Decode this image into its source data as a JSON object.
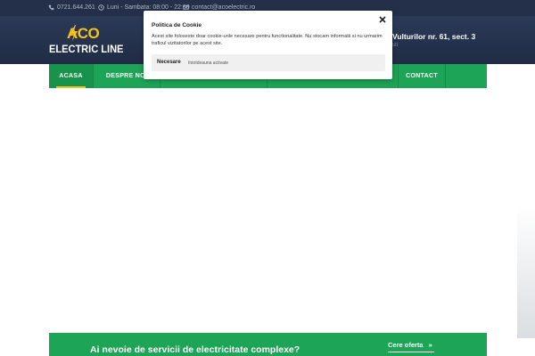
{
  "topbar": {
    "phone": "0721.644.261",
    "schedule": "Luni - Sambata: 08:00 - 22:00",
    "email": "contact@acoelectric.ro"
  },
  "header": {
    "logo_top": "ACO",
    "logo_bottom": "ELECTRIC LINE",
    "address": "Vulturilor nr. 61, sect. 3",
    "address_sub": "sti"
  },
  "nav": {
    "items": [
      {
        "label": "ACASA"
      },
      {
        "label": "DESPRE NOI"
      },
      {
        "label": ""
      },
      {
        "label": ""
      },
      {
        "label": "CONTACT"
      }
    ]
  },
  "cta": {
    "text": "Ai nevoie de servicii de electricitate complexe?",
    "button": "Cere oferta",
    "button_arrow": "»"
  },
  "cookie": {
    "title": "Politica de Cookie",
    "text": "Acest site foloseste doar cookie-urile necesare pentru functionalitate. Nu stocam informatii si nu urmarim traficul vizitatorilor pe acest site.",
    "pref_name": "Necesare",
    "pref_status": "întotdeauna activate"
  },
  "colors": {
    "topbar": "#243049",
    "header": "#2b3a57",
    "green": "#1ea456",
    "logo_yellow": "#f6c21c"
  }
}
